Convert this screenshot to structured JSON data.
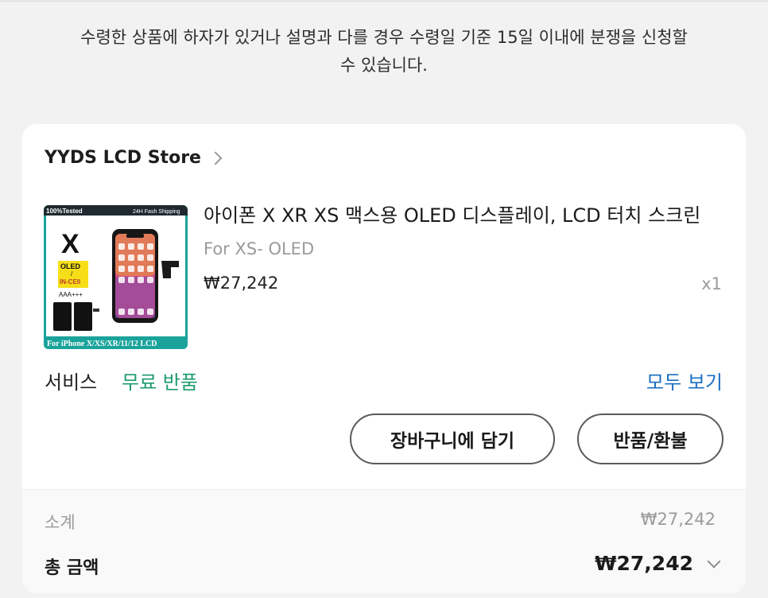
{
  "notice": {
    "line1": "수령한 상품에 하자가 있거나 설명과 다를 경우 수령일 기준 15일 이내에 분쟁을 신청할",
    "line2": "수 있습니다."
  },
  "order": {
    "store_name": "YYDS LCD Store",
    "product": {
      "title": "아이폰 X XR XS 맥스용 OLED 디스플레이, LCD 터치 스크린",
      "variant": "For XS- OLED",
      "price": "₩27,242",
      "quantity": "x1",
      "image_text": {
        "badge_tested": "100%Tested",
        "badge_shipping": "24H Fash Shipping",
        "model": "X",
        "tag_line1": "OLED",
        "tag_line2": "/",
        "tag_line3": "IN-CEll",
        "grade": "AAA+++",
        "footer": "For iPhone X/XS/XR/11/12 LCD"
      }
    },
    "service_label": "서비스",
    "service_value": "무료 반품",
    "see_all": "모두 보기",
    "add_to_cart": "장바구니에 담기",
    "return_refund": "반품/환불"
  },
  "summary": {
    "subtotal_label": "소계",
    "subtotal_value": "₩27,242",
    "total_label": "총 금액",
    "total_value": "₩27,242"
  },
  "colors": {
    "service_green": "#1d9b6c",
    "link_blue": "#1a6fc2",
    "thumb_border": "#1aa39b"
  },
  "icons": [
    "chevron-right-icon",
    "chevron-down-icon"
  ]
}
